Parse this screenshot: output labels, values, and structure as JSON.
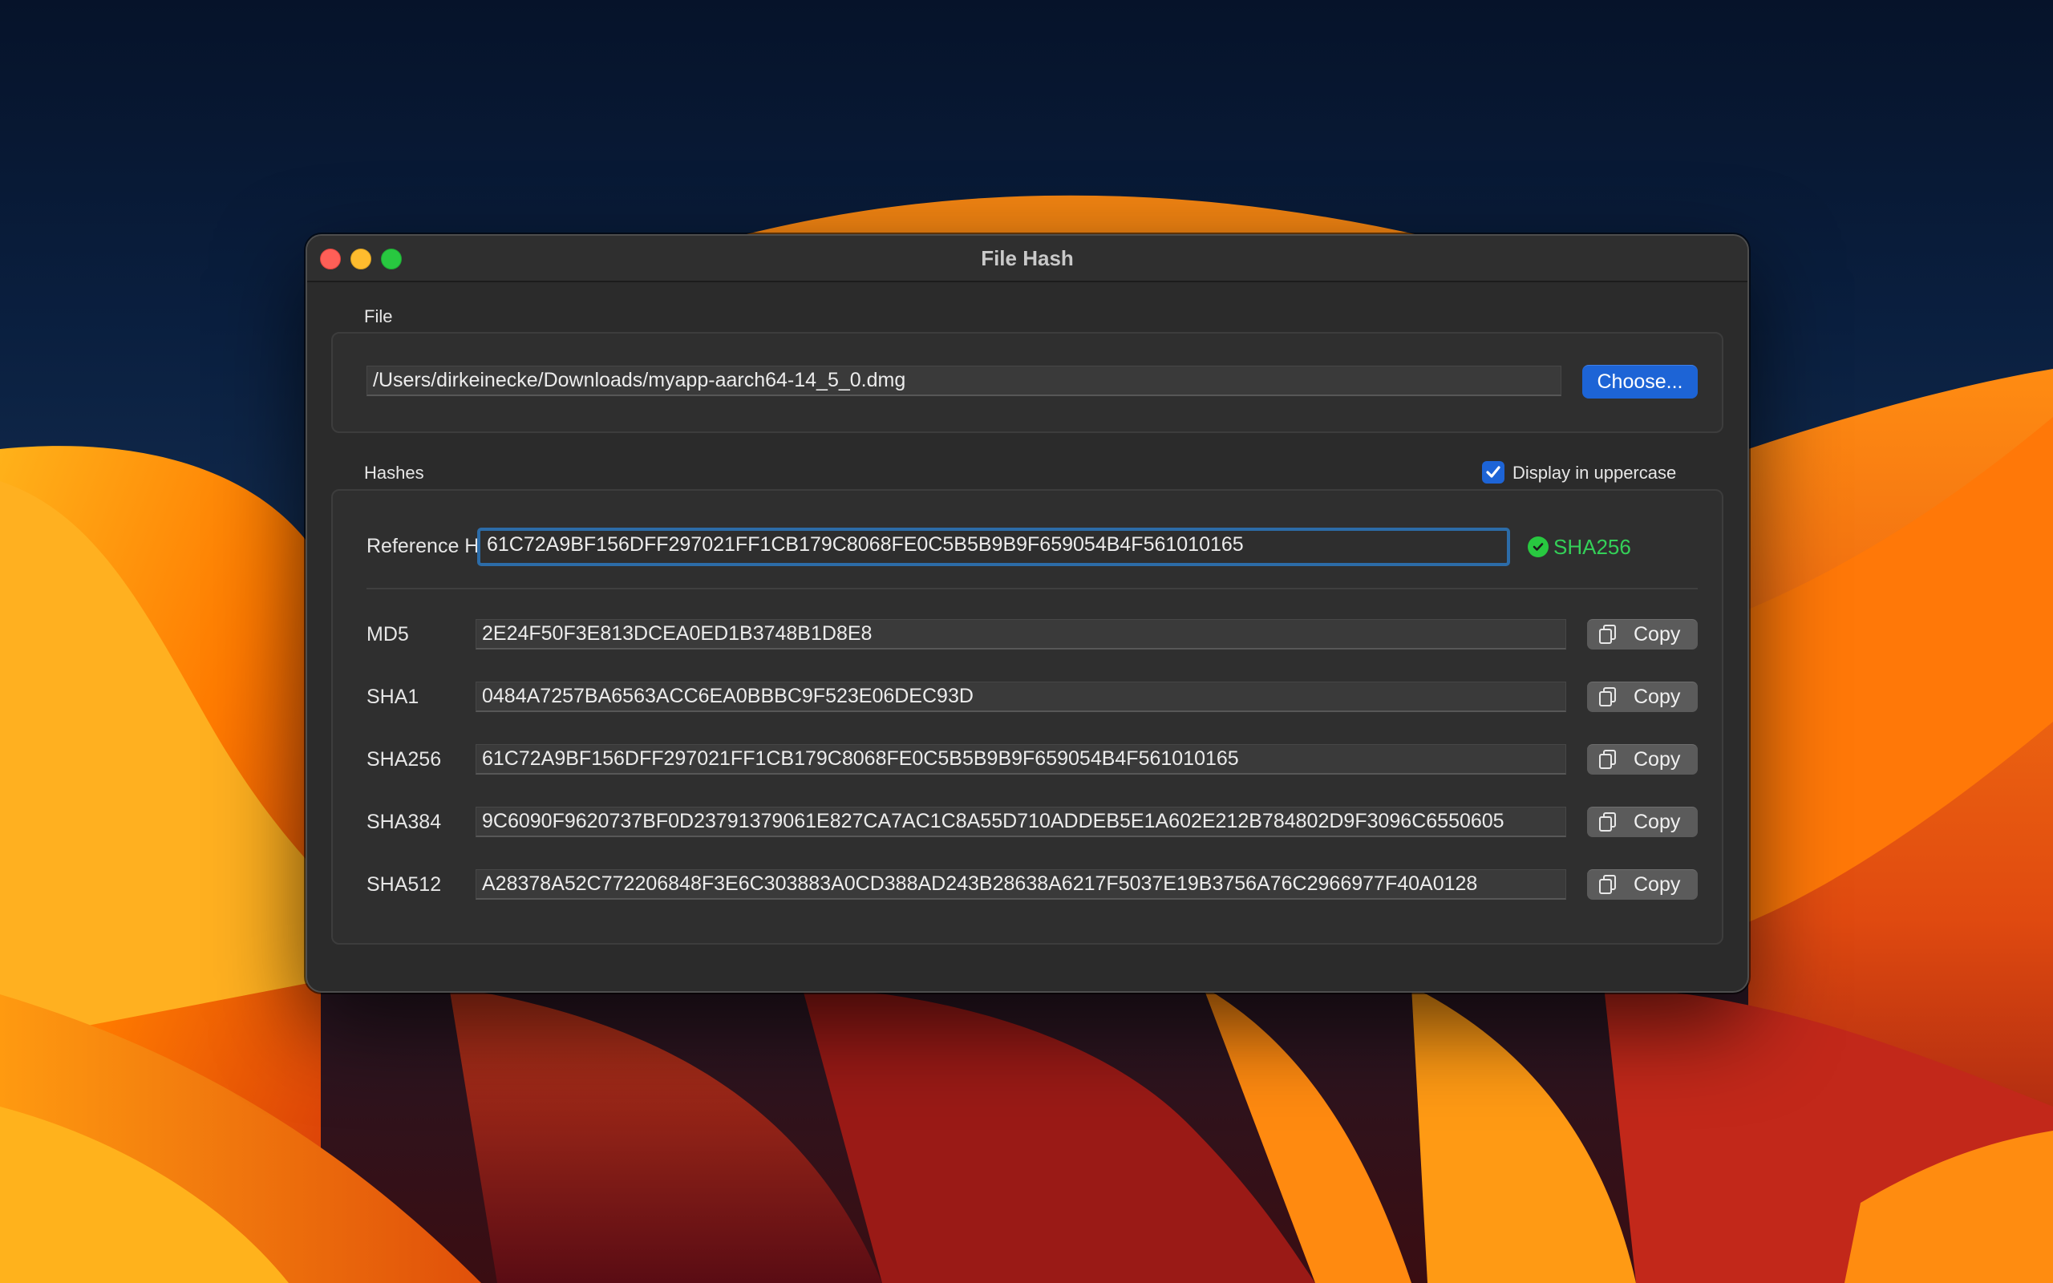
{
  "window": {
    "title": "File Hash"
  },
  "file_section": {
    "label": "File",
    "path": "/Users/dirkeinecke/Downloads/myapp-aarch64-14_5_0.dmg",
    "choose_label": "Choose..."
  },
  "hashes_section": {
    "label": "Hashes",
    "uppercase_label": "Display in uppercase",
    "uppercase_checked": true,
    "reference_label": "Reference Hash",
    "reference_value": "61C72A9BF156DFF297021FF1CB179C8068FE0C5B5B9B9F659054B4F561010165",
    "match_status": "SHA256",
    "copy_label": "Copy",
    "rows": [
      {
        "label": "MD5",
        "value": "2E24F50F3E813DCEA0ED1B3748B1D8E8"
      },
      {
        "label": "SHA1",
        "value": "0484A7257BA6563ACC6EA0BBBC9F523E06DEC93D"
      },
      {
        "label": "SHA256",
        "value": "61C72A9BF156DFF297021FF1CB179C8068FE0C5B5B9B9F659054B4F561010165"
      },
      {
        "label": "SHA384",
        "value": "9C6090F9620737BF0D23791379061E827CA7AC1C8A55D710ADDEB5E1A602E212B784802D9F3096C6550605"
      },
      {
        "label": "SHA512",
        "value": "A28378A52C772206848F3E6C303883A0CD388AD243B28638A6217F5037E19B3756A76C2966977F40A0128"
      }
    ]
  },
  "icons": {
    "check": "checkmark-icon",
    "status": "checkmark-circle-icon",
    "copy": "copy-documents-icon"
  },
  "colors": {
    "accent": "#1d64d6",
    "success": "#34d058",
    "window_bg": "#2b2b2b"
  }
}
